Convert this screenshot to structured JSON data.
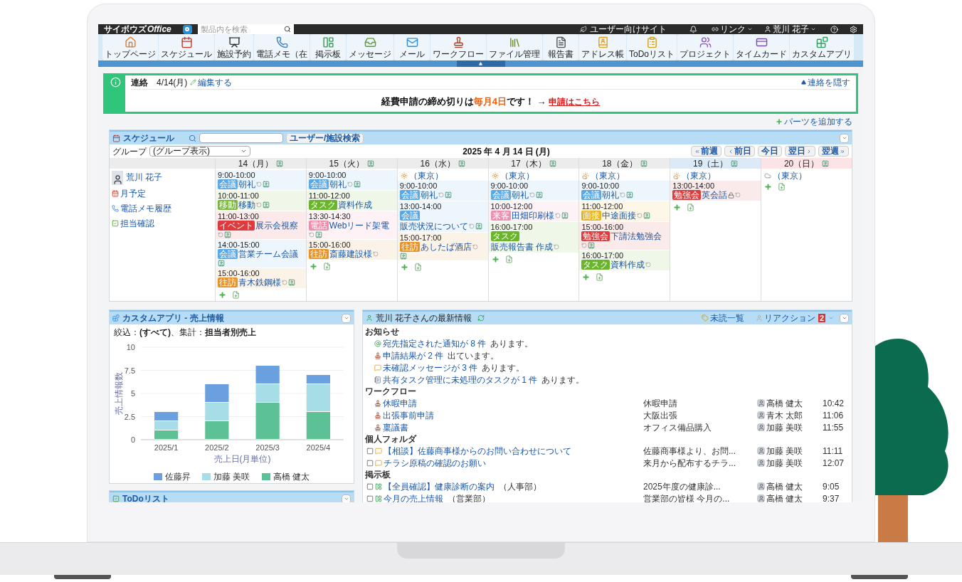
{
  "topbar": {
    "logo_prefix": "サイボウズ",
    "logo_name": "Office",
    "search": {
      "placeholder": "製品内を検索"
    },
    "site_link": "ユーザー向けサイト",
    "link_menu": "リンク",
    "user_name": "荒川 花子"
  },
  "toolbar": [
    {
      "label": "トップページ"
    },
    {
      "label": "スケジュール"
    },
    {
      "label": "施設予約"
    },
    {
      "label": "電話メモ（在"
    },
    {
      "label": "掲示板"
    },
    {
      "label": "メッセージ"
    },
    {
      "label": "メール"
    },
    {
      "label": "ワークフロー"
    },
    {
      "label": "ファイル管理"
    },
    {
      "label": "報告書"
    },
    {
      "label": "アドレス帳"
    },
    {
      "label": "ToDoリスト"
    },
    {
      "label": "プロジェクト"
    },
    {
      "label": "タイムカード"
    },
    {
      "label": "カスタムアプリ"
    }
  ],
  "notice": {
    "title": "連絡",
    "date": "4/14(月)",
    "edit": "編集する",
    "hide": "連絡を隠す",
    "message_before": "経費申請の締め切りは",
    "message_highlight": "毎月4日",
    "message_after": "です！ →",
    "message_link": "申請はこちら"
  },
  "add_parts": "パーツを追加する",
  "schedule": {
    "title": "スケジュール",
    "search_button": "ユーザー/施設検索",
    "group_label": "グループ",
    "group_select": "(グループ表示)",
    "date": "2025 年 4 月 14 日 (月)",
    "nav": [
      {
        "label": "前週",
        "kind": "back_week"
      },
      {
        "label": "前日",
        "kind": "back_day"
      },
      {
        "label": "今日",
        "kind": "today"
      },
      {
        "label": "翌日",
        "kind": "next_day"
      },
      {
        "label": "翌週",
        "kind": "next_week"
      }
    ],
    "user": {
      "name": "荒川 花子",
      "links": [
        "月予定",
        "電話メモ履歴",
        "担当確認"
      ]
    },
    "days": [
      {
        "label": "14（月）",
        "kind": "weekday",
        "events": [
          {
            "time": "9:00-10:00",
            "tag": "会議",
            "color": "#5aa9e6",
            "title": "朝礼",
            "repeat": true,
            "member": true,
            "locked": false
          },
          {
            "time": "10:00-11:00",
            "tag": "移動",
            "color": "#78b83a",
            "title": "移動",
            "repeat": true,
            "member": true,
            "locked": false
          },
          {
            "time": "11:00-13:00",
            "tag": "イベント",
            "color": "#e0393e",
            "title": "展示会視察",
            "repeat": true,
            "member": true,
            "locked": false
          },
          {
            "time": "14:00-15:00",
            "tag": "会議",
            "color": "#5aa9e6",
            "title": "営業チーム会議",
            "repeat": false,
            "member": true,
            "locked": false
          },
          {
            "time": "15:00-16:00",
            "tag": "往訪",
            "color": "#e8932a",
            "title": "青木鉄鋼様",
            "repeat": true,
            "member": true,
            "locked": false
          }
        ]
      },
      {
        "label": "15（火）",
        "kind": "weekday",
        "events": [
          {
            "time": "9:00-10:00",
            "tag": "会議",
            "color": "#5aa9e6",
            "title": "朝礼",
            "repeat": true,
            "member": true,
            "locked": false
          },
          {
            "time": "11:00-12:00",
            "tag": "タスク",
            "color": "#6bb52d",
            "title": "資料作成",
            "repeat": false,
            "member": false,
            "locked": false
          },
          {
            "time": "13:30-14:30",
            "tag": "電話",
            "color": "#f28cab",
            "title": "Webリード架電",
            "repeat": true,
            "member": true,
            "locked": false
          },
          {
            "time": "15:00-16:00",
            "tag": "往訪",
            "color": "#e8932a",
            "title": "斎藤建設様",
            "repeat": true,
            "member": false,
            "locked": false
          }
        ]
      },
      {
        "label": "16（水）",
        "kind": "weekday",
        "location": "（東京）",
        "events": [
          {
            "time": "9:00-10:00",
            "tag": "会議",
            "color": "#5aa9e6",
            "title": "朝礼",
            "repeat": true,
            "member": true,
            "locked": false
          },
          {
            "time": "13:00-14:00",
            "tag": "会議",
            "color": "#5aa9e6",
            "title": "販売状況について",
            "repeat": true,
            "member": true,
            "locked": false
          },
          {
            "time": "15:00-17:00",
            "tag": "往訪",
            "color": "#e8932a",
            "title": "あしたば酒店",
            "repeat": true,
            "member": true,
            "locked": false
          }
        ]
      },
      {
        "label": "17（木）",
        "kind": "weekday",
        "location": "（東京）",
        "events": [
          {
            "time": "9:00-10:00",
            "tag": "会議",
            "color": "#5aa9e6",
            "title": "朝礼",
            "repeat": true,
            "member": true,
            "locked": false
          },
          {
            "time": "10:00-12:00",
            "tag": "来客",
            "color": "#ee8fb2",
            "title": "田畑印刷様",
            "repeat": true,
            "member": true,
            "locked": false
          },
          {
            "time": "16:00-17:00",
            "tag": "タスク",
            "color": "#6bb52d",
            "title": "販売報告書 作成",
            "repeat": true,
            "member": false,
            "locked": false
          }
        ]
      },
      {
        "label": "18（金）",
        "kind": "weekday",
        "location": "（東京）",
        "events": [
          {
            "time": "9:00-10:00",
            "tag": "会議",
            "color": "#5aa9e6",
            "title": "朝礼",
            "repeat": true,
            "member": true,
            "locked": false
          },
          {
            "time": "11:00-12:00",
            "tag": "面接",
            "color": "#e6b422",
            "title": "中途面接",
            "repeat": true,
            "member": true,
            "locked": false
          },
          {
            "time": "15:00-16:00",
            "tag": "勉強会",
            "color": "#dc3d3d",
            "title": "下請法勉強会",
            "repeat": true,
            "member": true,
            "locked": false
          },
          {
            "time": "16:00-17:00",
            "tag": "タスク",
            "color": "#6bb52d",
            "title": "資料作成",
            "repeat": true,
            "member": false,
            "locked": false
          }
        ]
      },
      {
        "label": "19（土）",
        "kind": "saturday",
        "location": "（東京）",
        "events": [
          {
            "time": "13:00-14:00",
            "tag": "勉強会",
            "color": "#dc3d3d",
            "title": "英会話",
            "repeat": true,
            "member": false,
            "locked": true
          }
        ]
      },
      {
        "label": "20（日）",
        "kind": "sunday",
        "location": "（東京）"
      }
    ]
  },
  "custom_app": {
    "title": "カスタムアプリ - 売上情報",
    "filter": "絞込：**(すべて)**、集計：**担当者別売上**",
    "chart_data": {
      "type": "bar",
      "stacked": true,
      "grid": true,
      "legend": "bottom",
      "xlabel": "売上日(月単位)",
      "ylabel": "売上情報数",
      "categories": [
        "2025/1",
        "2025/2",
        "2025/3",
        "2025/4"
      ],
      "ylim": [
        0,
        10
      ],
      "yticks": [
        0,
        2.5,
        5,
        7.5,
        10
      ],
      "series": [
        {
          "name": "佐藤昇",
          "color": "#6a9fe0",
          "values": [
            1,
            2,
            2,
            1
          ]
        },
        {
          "name": "加藤 美咲",
          "color": "#a6dde6",
          "values": [
            1,
            2,
            2,
            3
          ]
        },
        {
          "name": "高橋 健太",
          "color": "#5cc295",
          "values": [
            1,
            2,
            4,
            3
          ]
        }
      ]
    }
  },
  "todo": {
    "title": "ToDoリスト"
  },
  "latest": {
    "title": "荒川 花子さんの最新情報",
    "unread": "未読一覧",
    "reaction": "リアクション",
    "reaction_count": "2",
    "sections": [
      {
        "heading": "お知らせ",
        "kind": "notice",
        "items": [
          {
            "link": "宛先指定された通知が 8 件",
            "suffix": "あります。"
          },
          {
            "link": "申請結果が 2 件",
            "suffix": "出ています。"
          },
          {
            "link": "未確認メッセージが 3 件",
            "suffix": "あります。"
          },
          {
            "link": "共有タスク管理に未処理のタスクが 1 件",
            "suffix": "あります。"
          }
        ]
      },
      {
        "heading": "ワークフロー",
        "kind": "workflow",
        "items": [
          {
            "title": "休暇申請",
            "detail": "休暇申請",
            "person": "高橋 健太",
            "time": "10:42"
          },
          {
            "title": "出張事前申請",
            "detail": "大阪出張",
            "person": "青木 太郎",
            "time": "11:06"
          },
          {
            "title": "稟議書",
            "detail": "オフィス備品購入",
            "person": "加藤 美咲",
            "time": "11:55"
          }
        ]
      },
      {
        "heading": "個人フォルダ",
        "kind": "folder",
        "items": [
          {
            "checked": false,
            "title": "【相談】佐藤商事様からのお問い合わせについて",
            "detail": "佐藤商事様より、お問...",
            "person": "加藤 美咲",
            "time": "11:11"
          },
          {
            "checked": false,
            "title": "チラシ原稿の確認のお願い",
            "detail": "来月から配布するチラ...",
            "person": "加藤 美咲",
            "time": "12:07"
          }
        ]
      },
      {
        "heading": "掲示板",
        "kind": "board",
        "items": [
          {
            "checked": false,
            "title": "【全員確認】健康診断の案内",
            "dept": "（人事部）",
            "detail": "2025年度の健康診...",
            "person": "高橋 健太",
            "time": "9:05"
          },
          {
            "checked": false,
            "title": "今月の売上情報",
            "dept": "（営業部）",
            "detail": "営業部の皆様 今月の...",
            "person": "高橋 健太",
            "time": "9:37"
          }
        ]
      }
    ]
  }
}
